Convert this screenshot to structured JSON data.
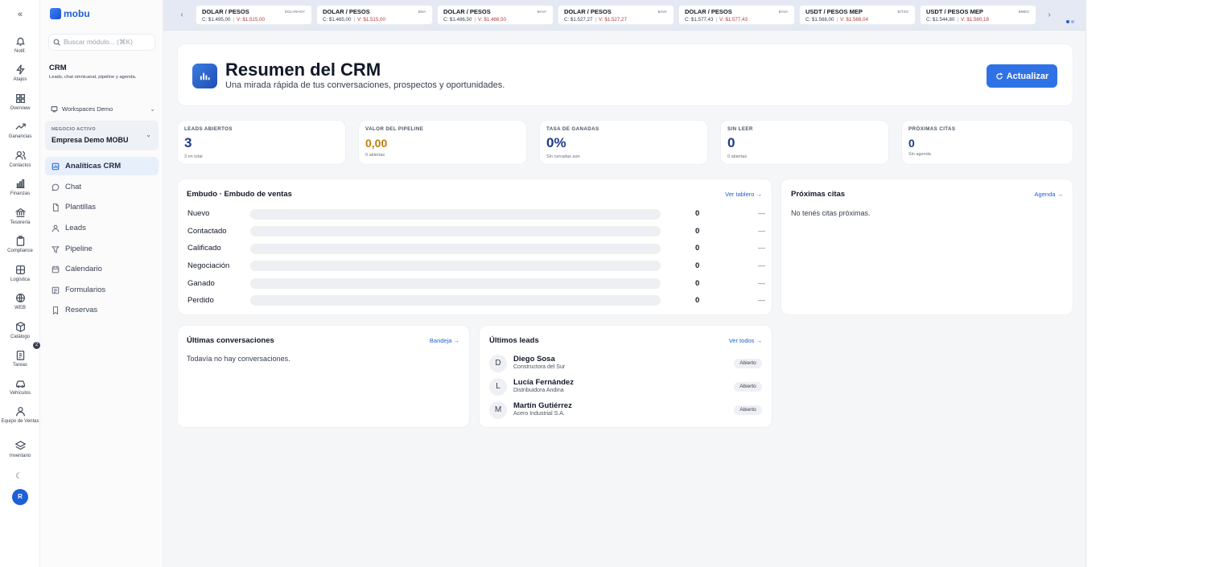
{
  "rail": {
    "items": [
      {
        "label": "Notif.",
        "icon": "bell-icon"
      },
      {
        "label": "Atajos",
        "icon": "bolt-icon"
      },
      {
        "label": "Overview",
        "icon": "grid-icon"
      },
      {
        "label": "Ganancias",
        "icon": "trend-icon"
      },
      {
        "label": "Contactos",
        "icon": "users-icon"
      },
      {
        "label": "Finanzas",
        "icon": "chart-icon"
      },
      {
        "label": "Tesorería",
        "icon": "bank-icon"
      },
      {
        "label": "Compliance",
        "icon": "clipboard-icon"
      },
      {
        "label": "Logística",
        "icon": "boxes-icon"
      },
      {
        "label": "WEB",
        "icon": "globe-icon"
      },
      {
        "label": "Catálogo",
        "icon": "package-icon"
      },
      {
        "label": "Tareas",
        "icon": "checklist-icon"
      },
      {
        "label": "Vehículos",
        "icon": "car-icon"
      },
      {
        "label": "Equipo de Ventas",
        "icon": "team-icon"
      },
      {
        "label": "Inventario",
        "icon": "layers-icon"
      }
    ],
    "tasks_badge": "2",
    "avatar_initial": "R"
  },
  "sidebar": {
    "logo_text": "mobu",
    "search_placeholder": "Buscar módulo... (⌘K)",
    "module_title": "CRM",
    "module_subtitle": "Leads, chat omnicanal, pipeline y agenda.",
    "workspace": "Workspaces Demo",
    "business_label": "NEGOCIO ACTIVO",
    "business_name": "Empresa Demo MOBU",
    "nav": [
      {
        "label": "Analíticas CRM",
        "icon": "analytics-icon",
        "active": true
      },
      {
        "label": "Chat",
        "icon": "chat-icon",
        "active": false
      },
      {
        "label": "Plantillas",
        "icon": "file-icon",
        "active": false
      },
      {
        "label": "Leads",
        "icon": "user-icon",
        "active": false
      },
      {
        "label": "Pipeline",
        "icon": "pipeline-icon",
        "active": false
      },
      {
        "label": "Calendario",
        "icon": "calendar-icon",
        "active": false
      },
      {
        "label": "Formularios",
        "icon": "form-icon",
        "active": false
      },
      {
        "label": "Reservas",
        "icon": "bookmark-icon",
        "active": false
      }
    ]
  },
  "ticker": [
    {
      "pair": "DOLAR / PESOS",
      "tag": "DOLARHOY",
      "buy": "C: $1.495,00",
      "sell": "V: $1.515,00"
    },
    {
      "pair": "DOLAR / PESOS",
      "tag": "BNA",
      "buy": "C: $1.465,00",
      "sell": "V: $1.515,00"
    },
    {
      "pair": "DOLAR / PESOS",
      "tag": "BAVA",
      "buy": "C: $1.486,50",
      "sell": "V: $1.486,50"
    },
    {
      "pair": "DOLAR / PESOS",
      "tag": "BAVA",
      "buy": "C: $1.527,27",
      "sell": "V: $1.527,27"
    },
    {
      "pair": "DOLAR / PESOS",
      "tag": "BAVA",
      "buy": "C: $1.577,43",
      "sell": "V: $1.577,43"
    },
    {
      "pair": "USDT / PESOS MEP",
      "tag": "BITSO",
      "buy": "C: $1.568,00",
      "sell": "V: $1.568,04"
    },
    {
      "pair": "USDT / PESOS MEP",
      "tag": "BMEO",
      "buy": "C: $1.544,80",
      "sell": "V: $1.580,18"
    }
  ],
  "hero": {
    "title": "Resumen del CRM",
    "subtitle": "Una mirada rápida de tus conversaciones, prospectos y oportunidades.",
    "refresh_label": "Actualizar"
  },
  "stats": [
    {
      "label": "LEADS ABIERTOS",
      "value": "3",
      "hint": "3 en total"
    },
    {
      "label": "VALOR DEL PIPELINE",
      "value": "0,00",
      "hint": "0 abiertas"
    },
    {
      "label": "TASA DE GANADAS",
      "value": "0%",
      "hint": "Sin cerradas aún"
    },
    {
      "label": "SIN LEER",
      "value": "0",
      "hint": "0 abiertas"
    },
    {
      "label": "PRÓXIMAS CITAS",
      "value": "0",
      "hint": "Sin agenda"
    }
  ],
  "funnel": {
    "title": "Embudo · Embudo de ventas",
    "link": "Ver tablero →",
    "stages": [
      {
        "name": "Nuevo",
        "count": "0",
        "fill": 0,
        "amount": "—"
      },
      {
        "name": "Contactado",
        "count": "0",
        "fill": 0,
        "amount": "—"
      },
      {
        "name": "Calificado",
        "count": "0",
        "fill": 0,
        "amount": "—"
      },
      {
        "name": "Negociación",
        "count": "0",
        "fill": 0,
        "amount": "—"
      },
      {
        "name": "Ganado",
        "count": "0",
        "fill": 0,
        "amount": "—"
      },
      {
        "name": "Perdido",
        "count": "0",
        "fill": 0,
        "amount": "—"
      }
    ]
  },
  "appointments": {
    "title": "Próximas citas",
    "link": "Agenda →",
    "empty": "No tenés citas próximas."
  },
  "conversations": {
    "title": "Últimas conversaciones",
    "link": "Bandeja →",
    "empty": "Todavía no hay conversaciones."
  },
  "leads": {
    "title": "Últimos leads",
    "link": "Ver todos →",
    "items": [
      {
        "initial": "D",
        "name": "Diego Sosa",
        "company": "Constructora del Sur",
        "status": "Abierto"
      },
      {
        "initial": "L",
        "name": "Lucía Fernández",
        "company": "Distribuidora Andina",
        "status": "Abierto"
      },
      {
        "initial": "M",
        "name": "Martín Gutiérrez",
        "company": "Acero Industrial S.A.",
        "status": "Abierto"
      }
    ]
  }
}
